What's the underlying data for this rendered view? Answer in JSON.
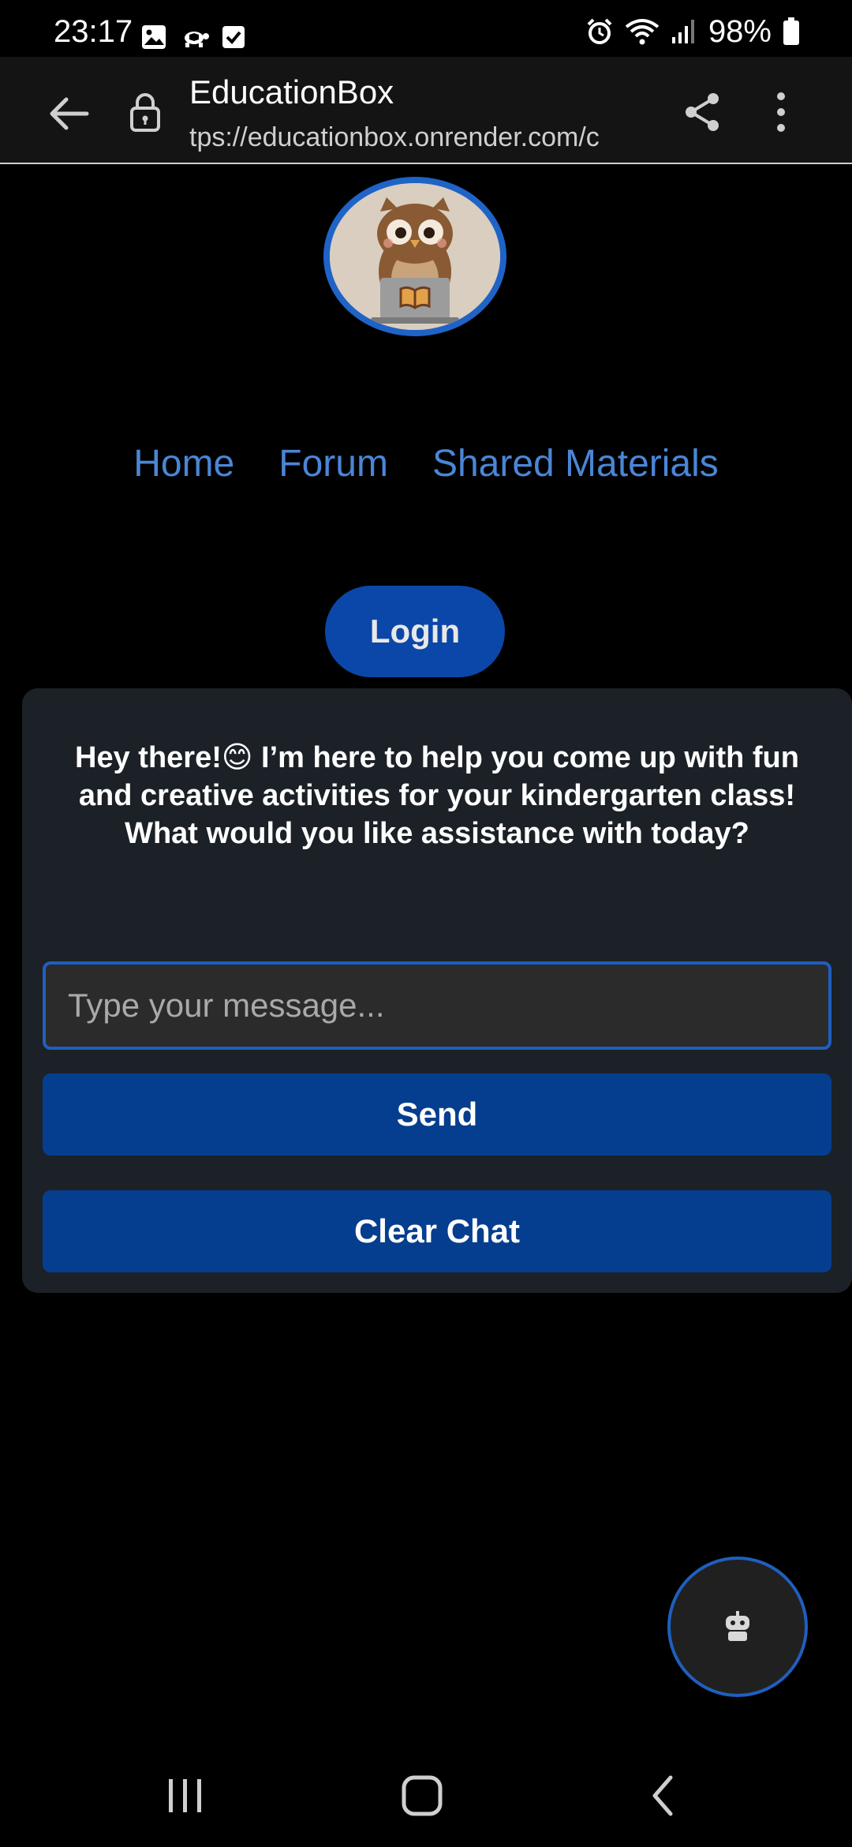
{
  "status_bar": {
    "time": "23:17",
    "battery": "98%"
  },
  "browser": {
    "title": "EducationBox",
    "url": "tps://educationbox.onrender.com/c"
  },
  "nav": {
    "links": [
      "Home",
      "Forum",
      "Shared Materials"
    ]
  },
  "login_label": "Login",
  "chat": {
    "message": "Hey there!😊 I’m here to help you come up with fun and creative activities for your kindergarten class! What would you like assistance with today?",
    "input_placeholder": "Type your message...",
    "send_label": "Send",
    "clear_label": "Clear Chat"
  },
  "colors": {
    "link": "#4a86d6",
    "primary_button": "#0b47a8",
    "panel": "#1b2126",
    "accent_border": "#1f5fbf"
  },
  "icons": [
    "image-icon",
    "turtle-icon",
    "checkbox-icon",
    "alarm-icon",
    "wifi-icon",
    "signal-icon",
    "battery-icon",
    "back-arrow-icon",
    "lock-icon",
    "share-icon",
    "more-vert-icon",
    "owl-logo",
    "robot-icon",
    "recents-icon",
    "home-icon",
    "back-icon"
  ]
}
